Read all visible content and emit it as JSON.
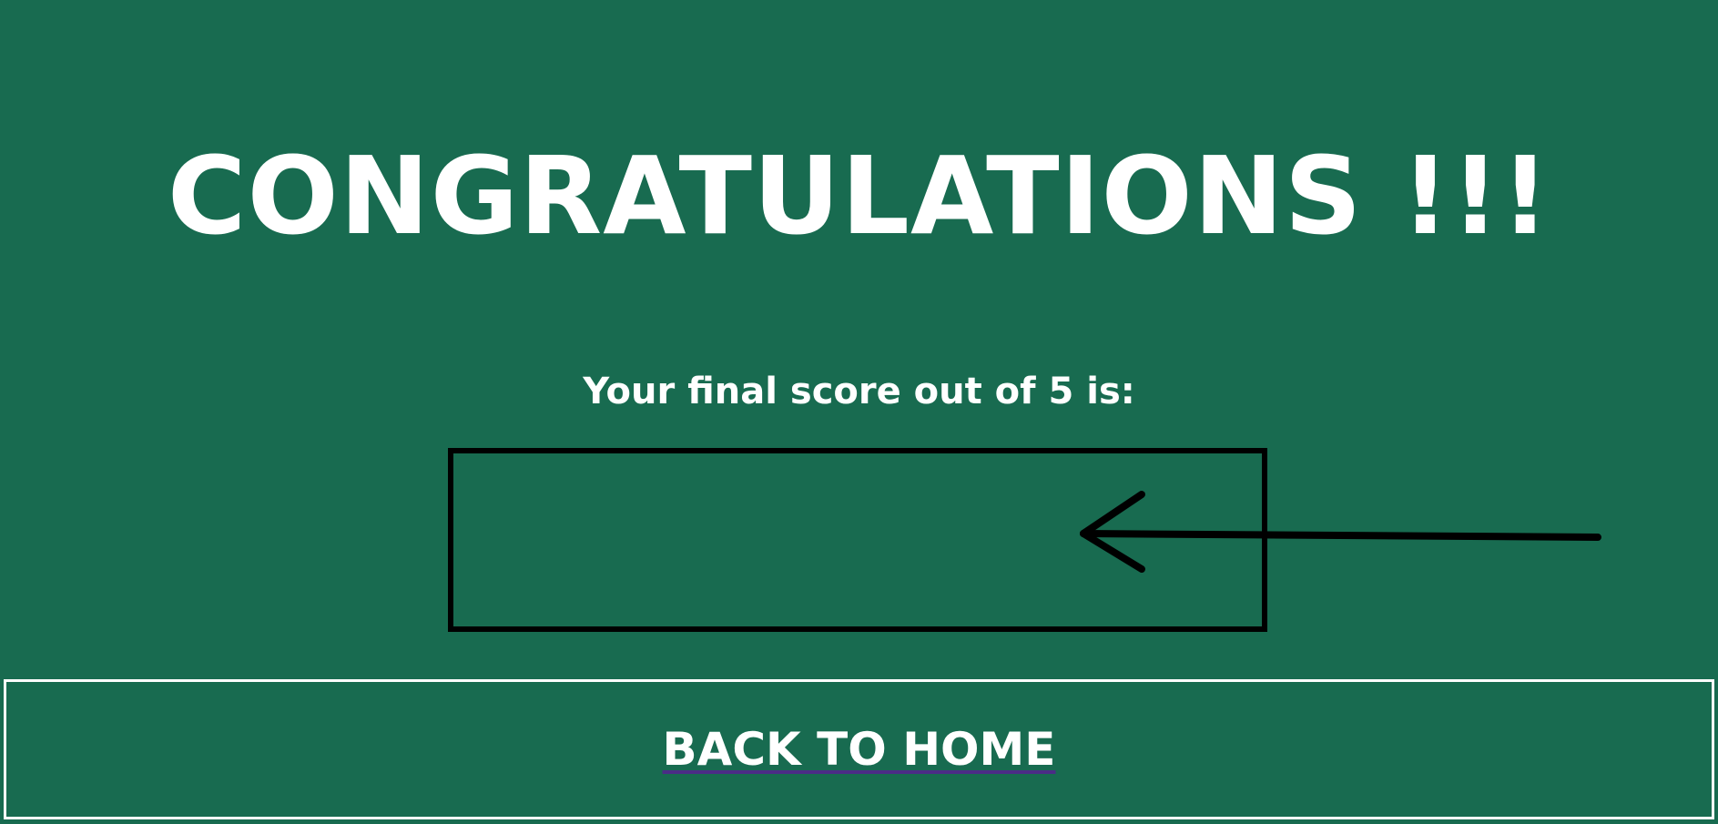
{
  "heading": "CONGRATULATIONS !!!",
  "score": {
    "label": "Your final score out of 5 is:",
    "value": ""
  },
  "navigation": {
    "back_label": "BACK TO HOME"
  },
  "colors": {
    "background": "#186b50",
    "text": "#ffffff",
    "box_border": "#000000",
    "link_underline": "#4b2c86"
  },
  "icons": {
    "pointer": "left-arrow-icon"
  }
}
